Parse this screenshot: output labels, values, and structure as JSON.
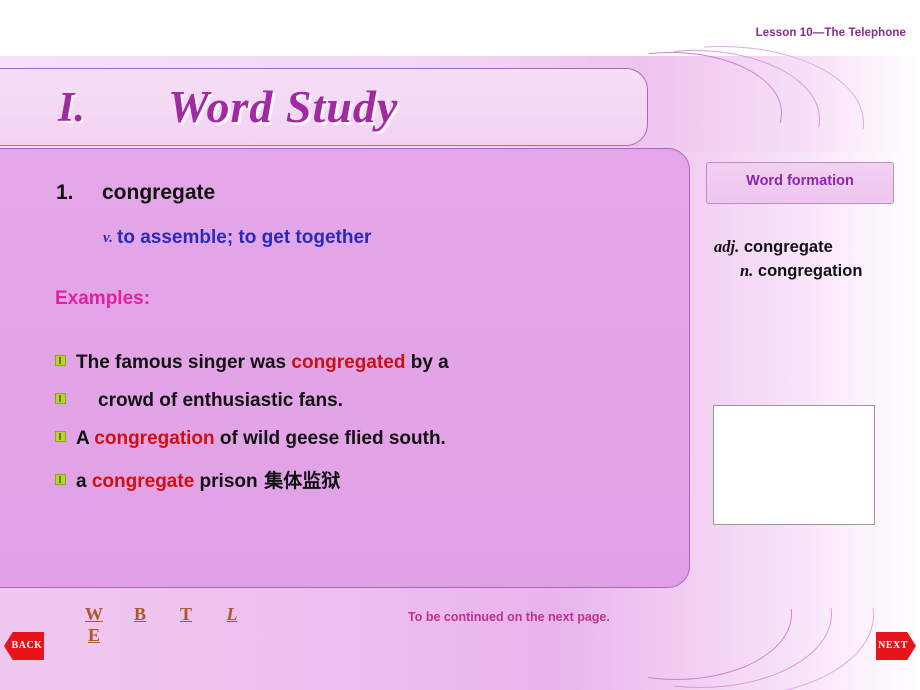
{
  "header": {
    "lesson_label": "Lesson 10—The Telephone"
  },
  "title": {
    "numeral": "I.",
    "text": "Word Study"
  },
  "entry": {
    "number": "1.",
    "headword": "congregate",
    "pos": "v.",
    "definition": "to assemble; to get together",
    "examples_label": "Examples:"
  },
  "examples": [
    {
      "parts": [
        {
          "t": "The famous singer was ",
          "hl": false
        },
        {
          "t": "congregated",
          "hl": true
        },
        {
          "t": " by a",
          "hl": false
        }
      ],
      "bullet": true,
      "indent": false
    },
    {
      "parts": [
        {
          "t": "crowd of enthusiastic fans.",
          "hl": false
        }
      ],
      "bullet": true,
      "indent": true
    },
    {
      "parts": [
        {
          "t": "A ",
          "hl": false
        },
        {
          "t": "congregation",
          "hl": true
        },
        {
          "t": " of wild geese flied south.",
          "hl": false
        }
      ],
      "bullet": true,
      "indent": false
    },
    {
      "parts": [
        {
          "t": "a ",
          "hl": false
        },
        {
          "t": "congregate",
          "hl": true
        },
        {
          "t": " prison",
          "hl": false
        },
        {
          "t": "     集体监狱",
          "hl": false,
          "cn": true
        }
      ],
      "bullet": true,
      "indent": false
    }
  ],
  "word_formation": {
    "title": "Word formation",
    "lines": [
      {
        "pos": "adj.",
        "word": "congregate"
      },
      {
        "pos": "n.",
        "word": "congregation"
      }
    ]
  },
  "footer": {
    "letters": [
      "W",
      "B",
      "T",
      "L",
      "E"
    ],
    "note": "To be continued on the next page.",
    "back": "BACK",
    "next": "NEXT"
  },
  "colors": {
    "title_purple": "#a02ba0",
    "definition_blue": "#2a2ab8",
    "examples_pink": "#e0219e",
    "highlight_red": "#d01010",
    "bullet_green": "#b9d42a",
    "nav_red": "#e8141c"
  }
}
